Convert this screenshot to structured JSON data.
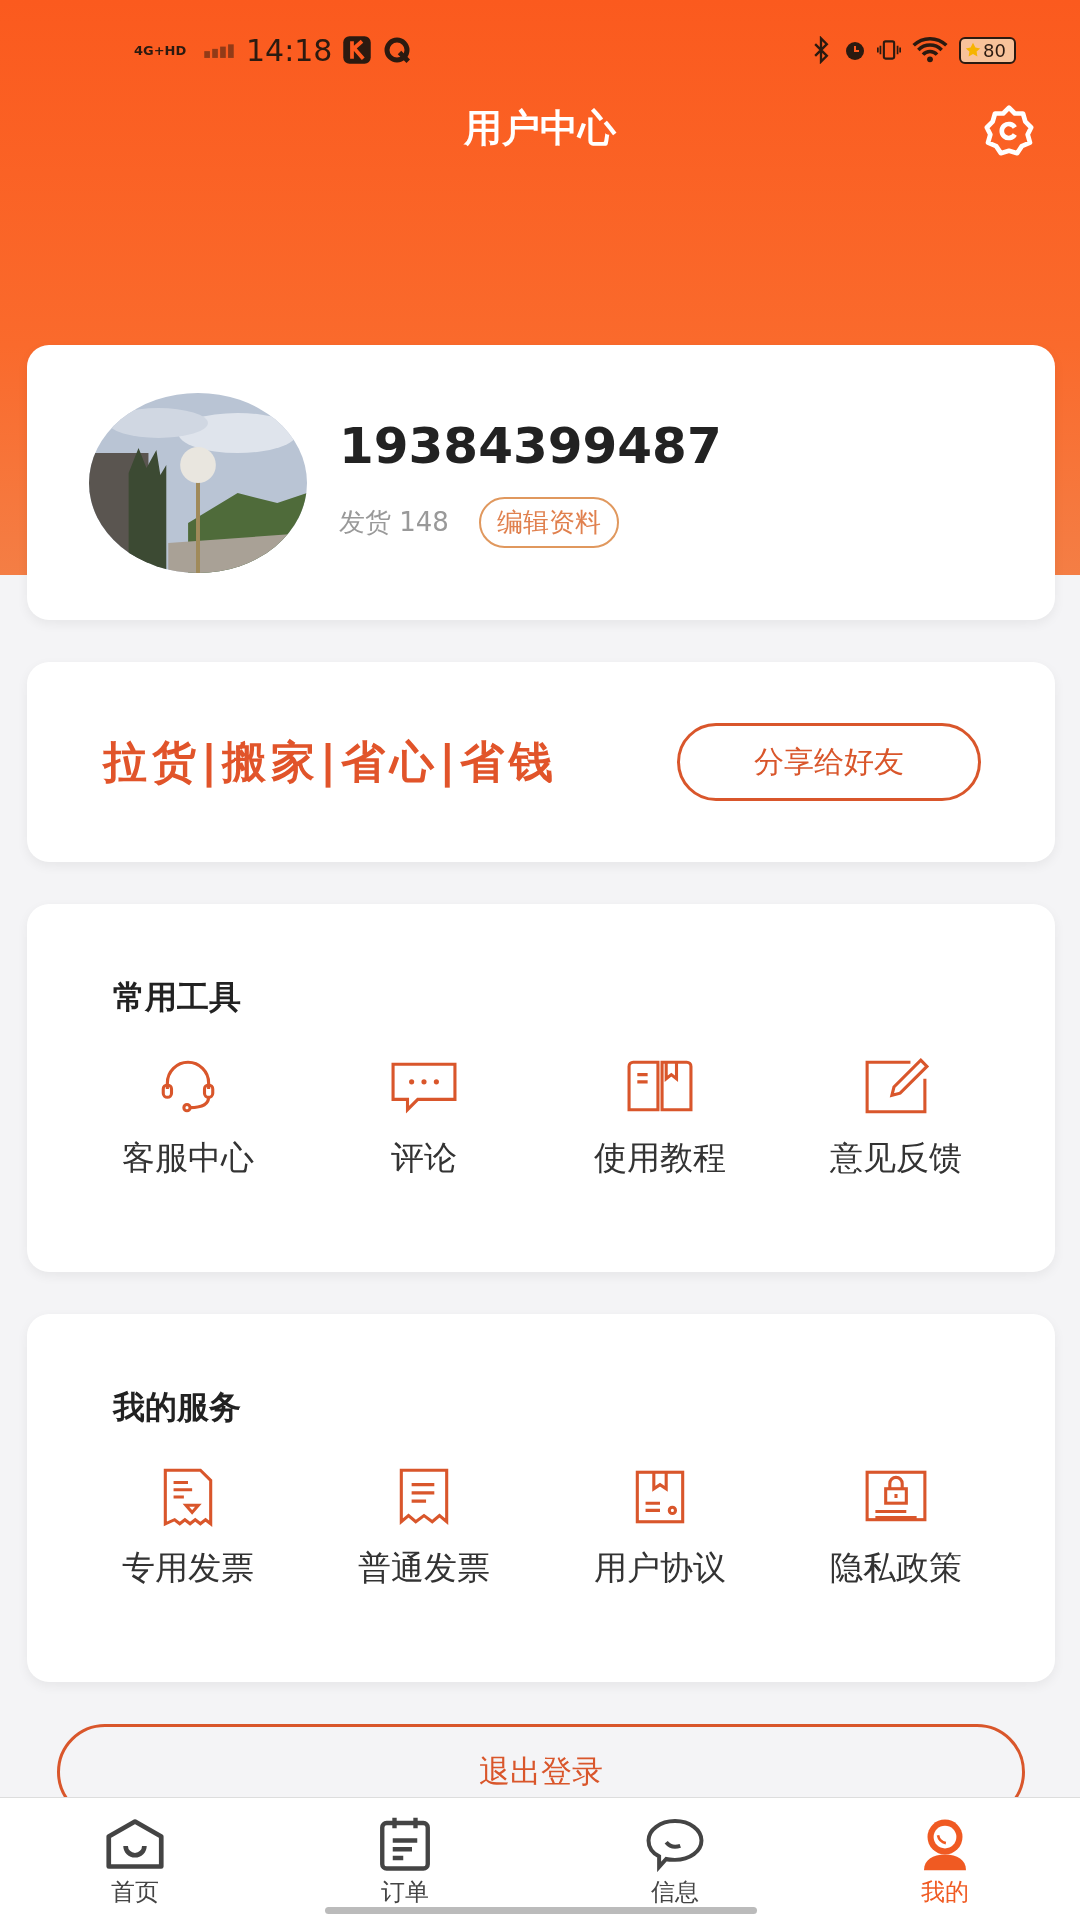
{
  "status_bar": {
    "network": "4G+HD",
    "time": "14:18",
    "battery": "80"
  },
  "header": {
    "title": "用户中心"
  },
  "profile": {
    "phone": "19384399487",
    "shipments": "发货 148",
    "edit_button": "编辑资料"
  },
  "promo": {
    "slogan": "拉货|搬家|省心|省钱",
    "share_button": "分享给好友"
  },
  "sections": [
    {
      "title": "常用工具",
      "items": [
        {
          "label": "客服中心",
          "kind": "headset"
        },
        {
          "label": "评论",
          "kind": "chat"
        },
        {
          "label": "使用教程",
          "kind": "book"
        },
        {
          "label": "意见反馈",
          "kind": "edit"
        }
      ]
    },
    {
      "title": "我的服务",
      "items": [
        {
          "label": "专用发票",
          "kind": "invoice"
        },
        {
          "label": "普通发票",
          "kind": "receipt"
        },
        {
          "label": "用户协议",
          "kind": "agreement"
        },
        {
          "label": "隐私政策",
          "kind": "lock"
        }
      ]
    }
  ],
  "logout_button": "退出登录",
  "tabs": [
    {
      "label": "首页",
      "kind": "home",
      "selected": false
    },
    {
      "label": "订单",
      "kind": "order",
      "selected": false
    },
    {
      "label": "信息",
      "kind": "message",
      "selected": false
    },
    {
      "label": "我的",
      "kind": "user",
      "selected": true
    }
  ]
}
